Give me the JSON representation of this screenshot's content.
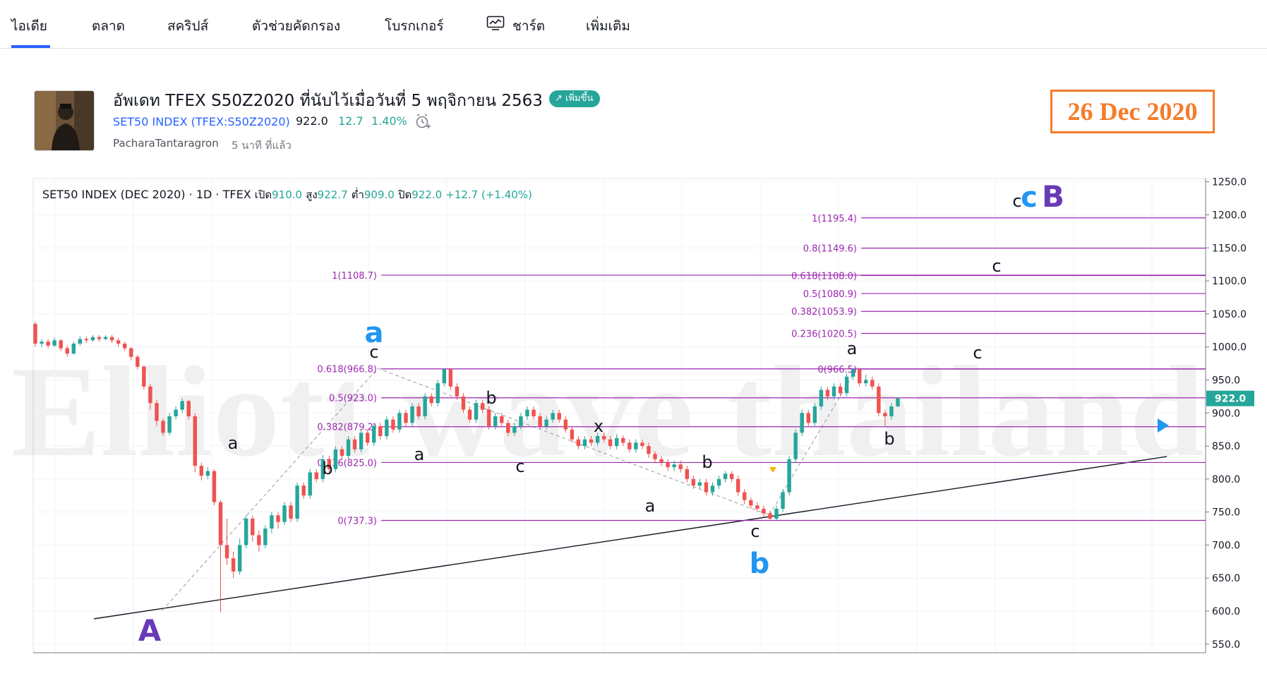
{
  "nav": {
    "items": [
      {
        "label": "ไอเดีย",
        "active": true
      },
      {
        "label": "ตลาด"
      },
      {
        "label": "สคริปส์"
      },
      {
        "label": "ตัวช่วยคัดกรอง"
      },
      {
        "label": "โบรกเกอร์"
      },
      {
        "label": "ชาร์ต",
        "icon": "chart-line-icon"
      },
      {
        "label": "เพิ่มเติม"
      }
    ]
  },
  "idea": {
    "title": "อัพเดท TFEX S50Z2020 ที่นับไว้เมื่อวันที่ 5 พฤจิกายน 2563",
    "badge": "เพิ่มขึ้น",
    "badge_icon": "arrow-up-right-icon",
    "symbol_name": "SET50 INDEX",
    "symbol_code": "(TFEX:S50Z2020)",
    "price": "922.0",
    "change": "12.7",
    "change_pct": "1.40%",
    "author": "PacharaTantaragron",
    "time_ago": "5 นาที ที่แล้ว",
    "date_overlay": "26 Dec 2020"
  },
  "legend": {
    "symbol": "SET50 INDEX (DEC 2020)",
    "sep1": "·",
    "interval": "1D",
    "sep2": "·",
    "exchange": "TFEX",
    "open_label": "เปิด",
    "open": "910.0",
    "high_label": "สูง",
    "high": "922.7",
    "low_label": "ต่ำ",
    "low": "909.0",
    "close_label": "ปิด",
    "close": "922.0",
    "change": "+12.7 (+1.40%)"
  },
  "watermark": "Elliott wave thailand",
  "colors": {
    "up": "#26a69a",
    "down": "#ef5350",
    "fib": "#9c27b0",
    "wave_blue": "#2196f3",
    "wave_purple": "#673ab7",
    "date_orange": "#f57c2a"
  },
  "chart_data": {
    "type": "candlestick",
    "ylim": [
      537,
      1255
    ],
    "y_ticks": [
      "1250.0",
      "1200.0",
      "1150.0",
      "1100.0",
      "1050.0",
      "1000.0",
      "950.0",
      "900.0",
      "850.0",
      "800.0",
      "750.0",
      "700.0",
      "650.0",
      "600.0",
      "550.0"
    ],
    "last_price_label": "922.0",
    "fib_levels": [
      {
        "label": "1(1195.4)",
        "value": 1195.4,
        "set": "right"
      },
      {
        "label": "0.8(1149.6)",
        "value": 1149.6,
        "set": "right"
      },
      {
        "label": "0.618(1108.0)",
        "value": 1108.0,
        "set": "right"
      },
      {
        "label": "0.5(1080.9)",
        "value": 1080.9,
        "set": "right"
      },
      {
        "label": "0.382(1053.9)",
        "value": 1053.9,
        "set": "right"
      },
      {
        "label": "0.236(1020.5)",
        "value": 1020.5,
        "set": "right"
      },
      {
        "label": "0(966.5)",
        "value": 966.5,
        "set": "right"
      },
      {
        "label": "1(1108.7)",
        "value": 1108.7,
        "set": "left"
      },
      {
        "label": "0.618(966.8)",
        "value": 966.8,
        "set": "left"
      },
      {
        "label": "0.5(923.0)",
        "value": 923.0,
        "set": "left"
      },
      {
        "label": "0.382(879.2)",
        "value": 879.2,
        "set": "left"
      },
      {
        "label": "0.236(825.0)",
        "value": 825.0,
        "set": "left"
      },
      {
        "label": "0(737.3)",
        "value": 737.3,
        "set": "left"
      }
    ],
    "wave_labels": [
      {
        "text": "A",
        "value": 574,
        "style": "major-purple"
      },
      {
        "text": "a",
        "value": 1020,
        "style": "major-blue"
      },
      {
        "text": "b",
        "value": 705,
        "style": "major-blue"
      },
      {
        "text": "c",
        "value": 1220,
        "style": "major-blue"
      },
      {
        "text": "B",
        "value": 1220,
        "style": "major-purple"
      },
      {
        "text": "a",
        "value": 855,
        "style": "minor"
      },
      {
        "text": "b",
        "value": 815,
        "style": "minor"
      },
      {
        "text": "c",
        "value": 975,
        "style": "minor"
      },
      {
        "text": "a",
        "value": 822,
        "style": "minor"
      },
      {
        "text": "b",
        "value": 925,
        "style": "minor"
      },
      {
        "text": "c",
        "value": 820,
        "style": "minor"
      },
      {
        "text": "x",
        "value": 885,
        "style": "minor"
      },
      {
        "text": "a",
        "value": 755,
        "style": "minor"
      },
      {
        "text": "b",
        "value": 822,
        "style": "minor"
      },
      {
        "text": "c",
        "value": 717,
        "style": "minor"
      },
      {
        "text": "a",
        "value": 976,
        "style": "minor"
      },
      {
        "text": "b",
        "value": 857,
        "style": "minor"
      },
      {
        "text": "c",
        "value": 966,
        "style": "minor"
      },
      {
        "text": "c",
        "value": 1120,
        "style": "minor"
      },
      {
        "text": "c",
        "value": 1218,
        "style": "minor"
      }
    ],
    "candles": [
      [
        1035,
        1005,
        1038,
        1000
      ],
      [
        1005,
        1008,
        1012,
        1000
      ],
      [
        1008,
        1002,
        1012,
        998
      ],
      [
        1002,
        1010,
        1014,
        1000
      ],
      [
        1010,
        998,
        1012,
        994
      ],
      [
        998,
        990,
        1002,
        985
      ],
      [
        990,
        1005,
        1008,
        988
      ],
      [
        1005,
        1012,
        1016,
        1002
      ],
      [
        1012,
        1010,
        1016,
        1006
      ],
      [
        1010,
        1015,
        1018,
        1008
      ],
      [
        1015,
        1012,
        1018,
        1008
      ],
      [
        1012,
        1015,
        1018,
        1010
      ],
      [
        1015,
        1010,
        1018,
        1006
      ],
      [
        1010,
        1005,
        1014,
        1000
      ],
      [
        1005,
        998,
        1008,
        994
      ],
      [
        998,
        985,
        1000,
        980
      ],
      [
        985,
        970,
        988,
        966
      ],
      [
        970,
        940,
        972,
        935
      ],
      [
        940,
        915,
        944,
        905
      ],
      [
        915,
        888,
        920,
        880
      ],
      [
        888,
        870,
        892,
        865
      ],
      [
        870,
        895,
        900,
        866
      ],
      [
        895,
        905,
        910,
        890
      ],
      [
        905,
        918,
        922,
        900
      ],
      [
        918,
        895,
        920,
        890
      ],
      [
        895,
        820,
        900,
        810
      ],
      [
        820,
        805,
        825,
        798
      ],
      [
        805,
        812,
        818,
        800
      ],
      [
        812,
        765,
        815,
        760
      ],
      [
        765,
        700,
        768,
        598
      ],
      [
        700,
        680,
        740,
        670
      ],
      [
        680,
        660,
        690,
        650
      ],
      [
        660,
        700,
        710,
        655
      ],
      [
        700,
        740,
        745,
        695
      ],
      [
        740,
        715,
        745,
        705
      ],
      [
        715,
        700,
        722,
        690
      ],
      [
        700,
        725,
        730,
        695
      ],
      [
        725,
        745,
        750,
        718
      ],
      [
        745,
        735,
        750,
        725
      ],
      [
        735,
        760,
        765,
        730
      ],
      [
        760,
        740,
        765,
        735
      ],
      [
        740,
        790,
        795,
        735
      ],
      [
        790,
        775,
        795,
        770
      ],
      [
        775,
        810,
        815,
        770
      ],
      [
        810,
        800,
        815,
        795
      ],
      [
        800,
        830,
        836,
        795
      ],
      [
        830,
        815,
        835,
        810
      ],
      [
        815,
        845,
        850,
        810
      ],
      [
        845,
        835,
        850,
        830
      ],
      [
        835,
        860,
        865,
        830
      ],
      [
        860,
        845,
        865,
        840
      ],
      [
        845,
        870,
        875,
        840
      ],
      [
        870,
        855,
        875,
        850
      ],
      [
        855,
        880,
        885,
        850
      ],
      [
        880,
        865,
        885,
        860
      ],
      [
        865,
        890,
        895,
        860
      ],
      [
        890,
        875,
        895,
        870
      ],
      [
        875,
        900,
        905,
        870
      ],
      [
        900,
        885,
        905,
        880
      ],
      [
        885,
        910,
        915,
        880
      ],
      [
        910,
        895,
        915,
        890
      ],
      [
        895,
        925,
        930,
        890
      ],
      [
        925,
        915,
        930,
        910
      ],
      [
        915,
        945,
        950,
        910
      ],
      [
        945,
        966,
        968,
        940
      ],
      [
        966,
        940,
        968,
        935
      ],
      [
        940,
        925,
        945,
        920
      ],
      [
        925,
        905,
        930,
        900
      ],
      [
        905,
        890,
        910,
        885
      ],
      [
        890,
        915,
        920,
        885
      ],
      [
        915,
        905,
        920,
        900
      ],
      [
        905,
        880,
        910,
        875
      ],
      [
        880,
        895,
        900,
        875
      ],
      [
        895,
        885,
        900,
        880
      ],
      [
        885,
        870,
        890,
        865
      ],
      [
        870,
        880,
        885,
        865
      ],
      [
        880,
        895,
        900,
        875
      ],
      [
        895,
        905,
        910,
        890
      ],
      [
        905,
        895,
        910,
        890
      ],
      [
        895,
        880,
        900,
        875
      ],
      [
        880,
        890,
        895,
        875
      ],
      [
        890,
        900,
        905,
        885
      ],
      [
        900,
        890,
        905,
        885
      ],
      [
        890,
        875,
        895,
        870
      ],
      [
        875,
        860,
        880,
        855
      ],
      [
        860,
        850,
        865,
        845
      ],
      [
        850,
        860,
        865,
        845
      ],
      [
        860,
        855,
        865,
        850
      ],
      [
        855,
        865,
        870,
        850
      ],
      [
        865,
        860,
        870,
        855
      ],
      [
        860,
        850,
        865,
        845
      ],
      [
        850,
        862,
        868,
        845
      ],
      [
        862,
        855,
        866,
        850
      ],
      [
        855,
        845,
        860,
        840
      ],
      [
        845,
        855,
        860,
        840
      ],
      [
        855,
        850,
        860,
        845
      ],
      [
        850,
        838,
        855,
        832
      ],
      [
        838,
        830,
        842,
        825
      ],
      [
        830,
        825,
        835,
        820
      ],
      [
        825,
        818,
        830,
        812
      ],
      [
        818,
        822,
        828,
        812
      ],
      [
        822,
        815,
        828,
        810
      ],
      [
        815,
        800,
        820,
        795
      ],
      [
        800,
        790,
        805,
        785
      ],
      [
        790,
        795,
        800,
        785
      ],
      [
        795,
        780,
        800,
        775
      ],
      [
        780,
        790,
        795,
        775
      ],
      [
        790,
        800,
        805,
        785
      ],
      [
        800,
        808,
        812,
        795
      ],
      [
        808,
        800,
        812,
        795
      ],
      [
        800,
        780,
        805,
        775
      ],
      [
        780,
        768,
        785,
        762
      ],
      [
        768,
        760,
        772,
        755
      ],
      [
        760,
        755,
        765,
        750
      ],
      [
        755,
        748,
        760,
        742
      ],
      [
        748,
        740,
        752,
        737
      ],
      [
        740,
        755,
        760,
        738
      ],
      [
        755,
        780,
        785,
        750
      ],
      [
        780,
        830,
        835,
        775
      ],
      [
        830,
        870,
        875,
        825
      ],
      [
        870,
        900,
        905,
        865
      ],
      [
        900,
        885,
        905,
        880
      ],
      [
        885,
        910,
        915,
        880
      ],
      [
        910,
        935,
        940,
        905
      ],
      [
        935,
        925,
        940,
        920
      ],
      [
        925,
        940,
        945,
        920
      ],
      [
        940,
        930,
        945,
        925
      ],
      [
        930,
        955,
        960,
        925
      ],
      [
        955,
        966,
        968,
        950
      ],
      [
        966,
        945,
        968,
        940
      ],
      [
        945,
        950,
        958,
        940
      ],
      [
        950,
        940,
        955,
        935
      ],
      [
        940,
        900,
        945,
        895
      ],
      [
        900,
        895,
        905,
        880
      ],
      [
        895,
        910,
        915,
        890
      ],
      [
        910,
        922,
        923,
        909
      ]
    ]
  }
}
